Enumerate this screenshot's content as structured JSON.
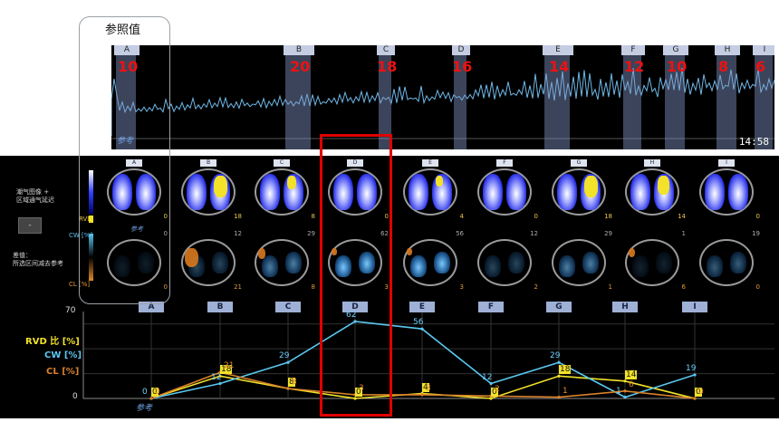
{
  "title": "参照值",
  "trace": {
    "phases": [
      {
        "tab": "A",
        "value": "10"
      },
      {
        "tab": "B",
        "value": "20"
      },
      {
        "tab": "C",
        "value": "18"
      },
      {
        "tab": "D",
        "value": "16"
      },
      {
        "tab": "E",
        "value": "14"
      },
      {
        "tab": "F",
        "value": "12"
      },
      {
        "tab": "G",
        "value": "10"
      },
      {
        "tab": "H",
        "value": "8"
      },
      {
        "tab": "I",
        "value": "6"
      }
    ],
    "time": "14:58",
    "ref_mark": "参考"
  },
  "images": {
    "side_top": "潮气图像 +\n区域通气延迟",
    "side_mid": "差值：\n所选区间减去参考",
    "minus_button": "-",
    "rvd_label": "RVD",
    "cw_label": "CW [%]",
    "cl_label": "CL [%]",
    "ref_mark": "参考",
    "columns": [
      {
        "tab": "A",
        "rvd": "0",
        "cw": "0",
        "cl": "0"
      },
      {
        "tab": "B",
        "rvd": "18",
        "cw": "12",
        "cl": "21"
      },
      {
        "tab": "C",
        "rvd": "8",
        "cw": "29",
        "cl": "8"
      },
      {
        "tab": "D",
        "rvd": "0",
        "cw": "62",
        "cl": "3"
      },
      {
        "tab": "E",
        "rvd": "4",
        "cw": "56",
        "cl": "3"
      },
      {
        "tab": "F",
        "rvd": "0",
        "cw": "12",
        "cl": "2"
      },
      {
        "tab": "G",
        "rvd": "18",
        "cw": "29",
        "cl": "1"
      },
      {
        "tab": "H",
        "rvd": "14",
        "cw": "1",
        "cl": "6"
      },
      {
        "tab": "I",
        "rvd": "0",
        "cw": "19",
        "cl": "0"
      }
    ]
  },
  "chart_data": {
    "type": "line",
    "categories": [
      "A",
      "B",
      "C",
      "D",
      "E",
      "F",
      "G",
      "H",
      "I"
    ],
    "ylim": [
      0,
      70
    ],
    "yticks": [
      "70",
      "0"
    ],
    "series": [
      {
        "name": "RVD 比 [%]",
        "color": "#f2e22a",
        "values": [
          0,
          18,
          8,
          0,
          4,
          0,
          18,
          14,
          0
        ]
      },
      {
        "name": "CW [%]",
        "color": "#5bc8f0",
        "values": [
          0,
          12,
          29,
          62,
          56,
          12,
          29,
          1,
          19
        ]
      },
      {
        "name": "CL [%]",
        "color": "#d9822b",
        "values": [
          0,
          21,
          8,
          3,
          3,
          2,
          1,
          6,
          0
        ]
      }
    ],
    "ref_mark": "参考"
  }
}
